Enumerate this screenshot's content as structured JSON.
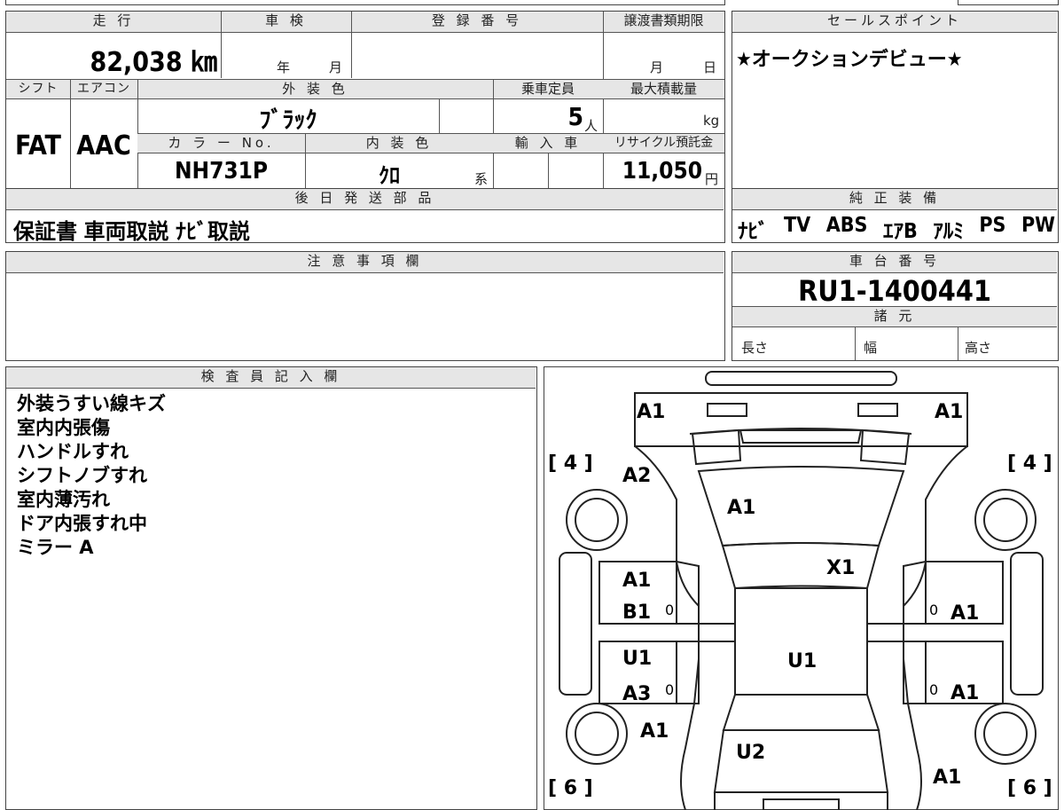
{
  "vehicle": {
    "mileage_label": "走 行",
    "mileage_value": "82,038 ㎞",
    "inspection_label": "車 検",
    "inspection_year_unit": "年",
    "inspection_month_unit": "月",
    "registration_label": "登 録 番 号",
    "transfer_label": "譲渡書類期限",
    "transfer_month_unit": "月",
    "transfer_day_unit": "日",
    "shift_label": "シフト",
    "shift_value": "FAT",
    "ac_label": "エアコン",
    "ac_value": "AAC",
    "exterior_label": "外 装 色",
    "exterior_value": "ﾌﾞﾗｯｸ",
    "capacity_label": "乗車定員",
    "capacity_value": "5",
    "capacity_unit": "人",
    "load_label": "最大積載量",
    "load_unit": "kg",
    "color_no_label": "カ ラ ー No.",
    "color_no_value": "NH731P",
    "interior_label": "内 装 色",
    "interior_value": "ｸﾛ",
    "interior_unit": "系",
    "import_label": "輸 入 車",
    "recycle_label": "リサイクル預託金",
    "recycle_value": "11,050",
    "recycle_unit": "円"
  },
  "sales_point": {
    "label": "セールスポイント",
    "text": "★オークションデビュー★"
  },
  "later_parts": {
    "label": "後 日 発 送 部 品",
    "text": "保証書 車両取説 ﾅﾋﾞ取説"
  },
  "genuine_equipment": {
    "label": "純 正 装 備",
    "items": [
      "ﾅﾋﾞ",
      "TV",
      "ABS",
      "ｴｱB",
      "ｱﾙﾐ",
      "PS",
      "PW"
    ]
  },
  "notes": {
    "label": "注 意 事 項 欄"
  },
  "chassis": {
    "label": "車 台 番 号",
    "value": "RU1-1400441",
    "spec_label": "諸 元",
    "length_label": "長さ",
    "width_label": "幅",
    "height_label": "高さ"
  },
  "inspector": {
    "label": "検 査 員 記 入 欄",
    "lines": [
      "外装うすい線キズ",
      "室内内張傷",
      "ハンドルすれ",
      "シフトノブすれ",
      "室内薄汚れ",
      "ドア内張すれ中",
      "ミラー A"
    ]
  },
  "diagram": {
    "marks": {
      "front_left_corner": "A1",
      "front_right_corner": "A1",
      "tire_fl": "[ 4 ]",
      "tire_fr": "[ 4 ]",
      "fender_left": "A2",
      "hood": "A1",
      "windshield": "X1",
      "front_door_left_1": "A1",
      "front_door_left_2": "B1",
      "front_door_right": "A1",
      "rear_door_left_1": "U1",
      "rear_door_left_2": "A3",
      "rear_door_right": "A1",
      "roof": "U1",
      "rear_left_quarter": "A1",
      "rear_glass": "U2",
      "rear_right_quarter": "A1",
      "tire_rl": "[ 6 ]",
      "tire_rr": "[ 6 ]",
      "small_0a": "0",
      "small_0b": "0",
      "small_0c": "0",
      "small_0d": "0"
    }
  }
}
